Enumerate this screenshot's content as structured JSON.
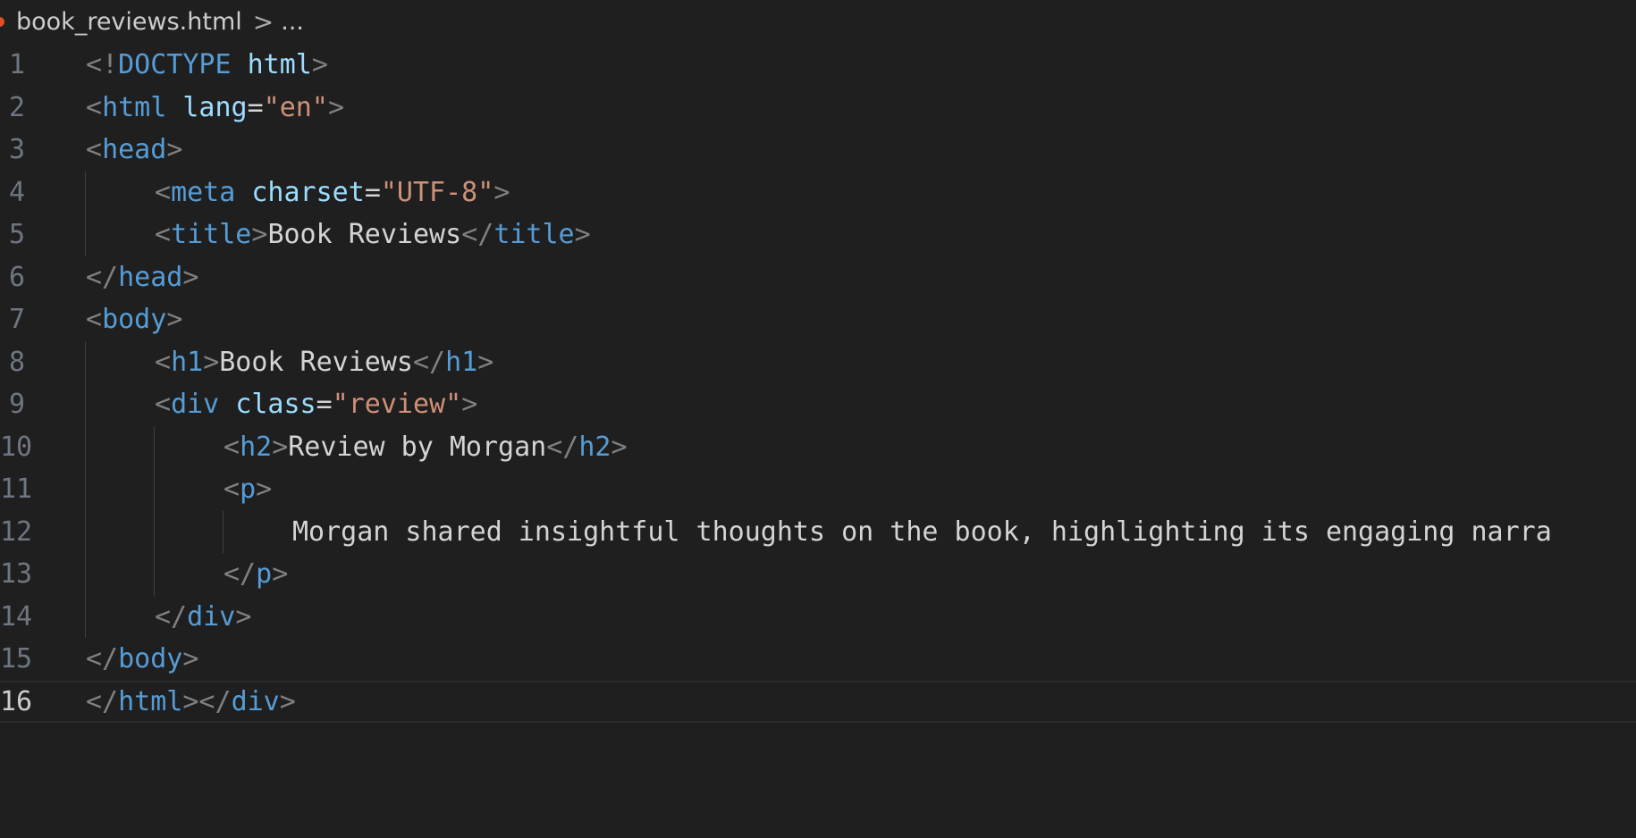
{
  "breadcrumb": {
    "file": "book_reviews.html",
    "separator": ">",
    "more": "..."
  },
  "editor": {
    "current_line": 16,
    "lines": [
      {
        "number": "1",
        "indent": 0,
        "tokens": [
          {
            "t": "<!",
            "c": "punc"
          },
          {
            "t": "DOCTYPE",
            "c": "tag"
          },
          {
            "t": " ",
            "c": "text"
          },
          {
            "t": "html",
            "c": "attr"
          },
          {
            "t": ">",
            "c": "punc"
          }
        ]
      },
      {
        "number": "2",
        "indent": 0,
        "tokens": [
          {
            "t": "<",
            "c": "punc"
          },
          {
            "t": "html",
            "c": "tag"
          },
          {
            "t": " ",
            "c": "text"
          },
          {
            "t": "lang",
            "c": "attr"
          },
          {
            "t": "=",
            "c": "text"
          },
          {
            "t": "\"en\"",
            "c": "str"
          },
          {
            "t": ">",
            "c": "punc"
          }
        ]
      },
      {
        "number": "3",
        "indent": 0,
        "tokens": [
          {
            "t": "<",
            "c": "punc"
          },
          {
            "t": "head",
            "c": "tag"
          },
          {
            "t": ">",
            "c": "punc"
          }
        ]
      },
      {
        "number": "4",
        "indent": 1,
        "tokens": [
          {
            "t": "<",
            "c": "punc"
          },
          {
            "t": "meta",
            "c": "tag"
          },
          {
            "t": " ",
            "c": "text"
          },
          {
            "t": "charset",
            "c": "attr"
          },
          {
            "t": "=",
            "c": "text"
          },
          {
            "t": "\"UTF-8\"",
            "c": "str"
          },
          {
            "t": ">",
            "c": "punc"
          }
        ]
      },
      {
        "number": "5",
        "indent": 1,
        "tokens": [
          {
            "t": "<",
            "c": "punc"
          },
          {
            "t": "title",
            "c": "tag"
          },
          {
            "t": ">",
            "c": "punc"
          },
          {
            "t": "Book Reviews",
            "c": "text"
          },
          {
            "t": "</",
            "c": "punc"
          },
          {
            "t": "title",
            "c": "tag"
          },
          {
            "t": ">",
            "c": "punc"
          }
        ]
      },
      {
        "number": "6",
        "indent": 0,
        "tokens": [
          {
            "t": "</",
            "c": "punc"
          },
          {
            "t": "head",
            "c": "tag"
          },
          {
            "t": ">",
            "c": "punc"
          }
        ]
      },
      {
        "number": "7",
        "indent": 0,
        "tokens": [
          {
            "t": "<",
            "c": "punc"
          },
          {
            "t": "body",
            "c": "tag"
          },
          {
            "t": ">",
            "c": "punc"
          }
        ]
      },
      {
        "number": "8",
        "indent": 1,
        "tokens": [
          {
            "t": "<",
            "c": "punc"
          },
          {
            "t": "h1",
            "c": "tag"
          },
          {
            "t": ">",
            "c": "punc"
          },
          {
            "t": "Book Reviews",
            "c": "text"
          },
          {
            "t": "</",
            "c": "punc"
          },
          {
            "t": "h1",
            "c": "tag"
          },
          {
            "t": ">",
            "c": "punc"
          }
        ]
      },
      {
        "number": "9",
        "indent": 1,
        "tokens": [
          {
            "t": "<",
            "c": "punc"
          },
          {
            "t": "div",
            "c": "tag"
          },
          {
            "t": " ",
            "c": "text"
          },
          {
            "t": "class",
            "c": "attr"
          },
          {
            "t": "=",
            "c": "text"
          },
          {
            "t": "\"review\"",
            "c": "str"
          },
          {
            "t": ">",
            "c": "punc"
          }
        ]
      },
      {
        "number": "10",
        "indent": 2,
        "tokens": [
          {
            "t": "<",
            "c": "punc"
          },
          {
            "t": "h2",
            "c": "tag"
          },
          {
            "t": ">",
            "c": "punc"
          },
          {
            "t": "Review by Morgan",
            "c": "text"
          },
          {
            "t": "</",
            "c": "punc"
          },
          {
            "t": "h2",
            "c": "tag"
          },
          {
            "t": ">",
            "c": "punc"
          }
        ]
      },
      {
        "number": "11",
        "indent": 2,
        "tokens": [
          {
            "t": "<",
            "c": "punc"
          },
          {
            "t": "p",
            "c": "tag"
          },
          {
            "t": ">",
            "c": "punc"
          }
        ]
      },
      {
        "number": "12",
        "indent": 3,
        "tokens": [
          {
            "t": "Morgan shared insightful thoughts on the book, highlighting its engaging narra",
            "c": "text"
          }
        ]
      },
      {
        "number": "13",
        "indent": 2,
        "tokens": [
          {
            "t": "</",
            "c": "punc"
          },
          {
            "t": "p",
            "c": "tag"
          },
          {
            "t": ">",
            "c": "punc"
          }
        ]
      },
      {
        "number": "14",
        "indent": 1,
        "tokens": [
          {
            "t": "</",
            "c": "punc"
          },
          {
            "t": "div",
            "c": "tag"
          },
          {
            "t": ">",
            "c": "punc"
          }
        ]
      },
      {
        "number": "15",
        "indent": 0,
        "tokens": [
          {
            "t": "</",
            "c": "punc"
          },
          {
            "t": "body",
            "c": "tag"
          },
          {
            "t": ">",
            "c": "punc"
          }
        ]
      },
      {
        "number": "16",
        "indent": 0,
        "tokens": [
          {
            "t": "</",
            "c": "punc"
          },
          {
            "t": "html",
            "c": "tag"
          },
          {
            "t": "></",
            "c": "punc"
          },
          {
            "t": "div",
            "c": "tag"
          },
          {
            "t": ">",
            "c": "punc"
          }
        ]
      }
    ]
  }
}
